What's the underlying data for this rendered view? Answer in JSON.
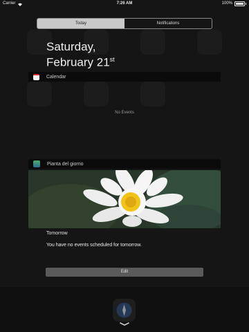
{
  "status_bar": {
    "carrier": "Carrier",
    "time": "7:26 AM",
    "battery": "100%"
  },
  "tabs": [
    {
      "label": "Today",
      "selected": true
    },
    {
      "label": "Notifications",
      "selected": false
    }
  ],
  "date": {
    "weekday_line": "Saturday,",
    "date_line": "February 21",
    "suffix": "st"
  },
  "calendar": {
    "title": "Calendar",
    "empty_text": "No Events"
  },
  "plant_widget": {
    "title": "Pianta del giorno"
  },
  "tomorrow": {
    "title": "Tomorrow",
    "text": "You have no events scheduled for tomorrow."
  },
  "edit_button": {
    "label": "Edit"
  },
  "colors": {
    "accent_red": "#d9302a",
    "segment_active": "#c9c9c9"
  }
}
